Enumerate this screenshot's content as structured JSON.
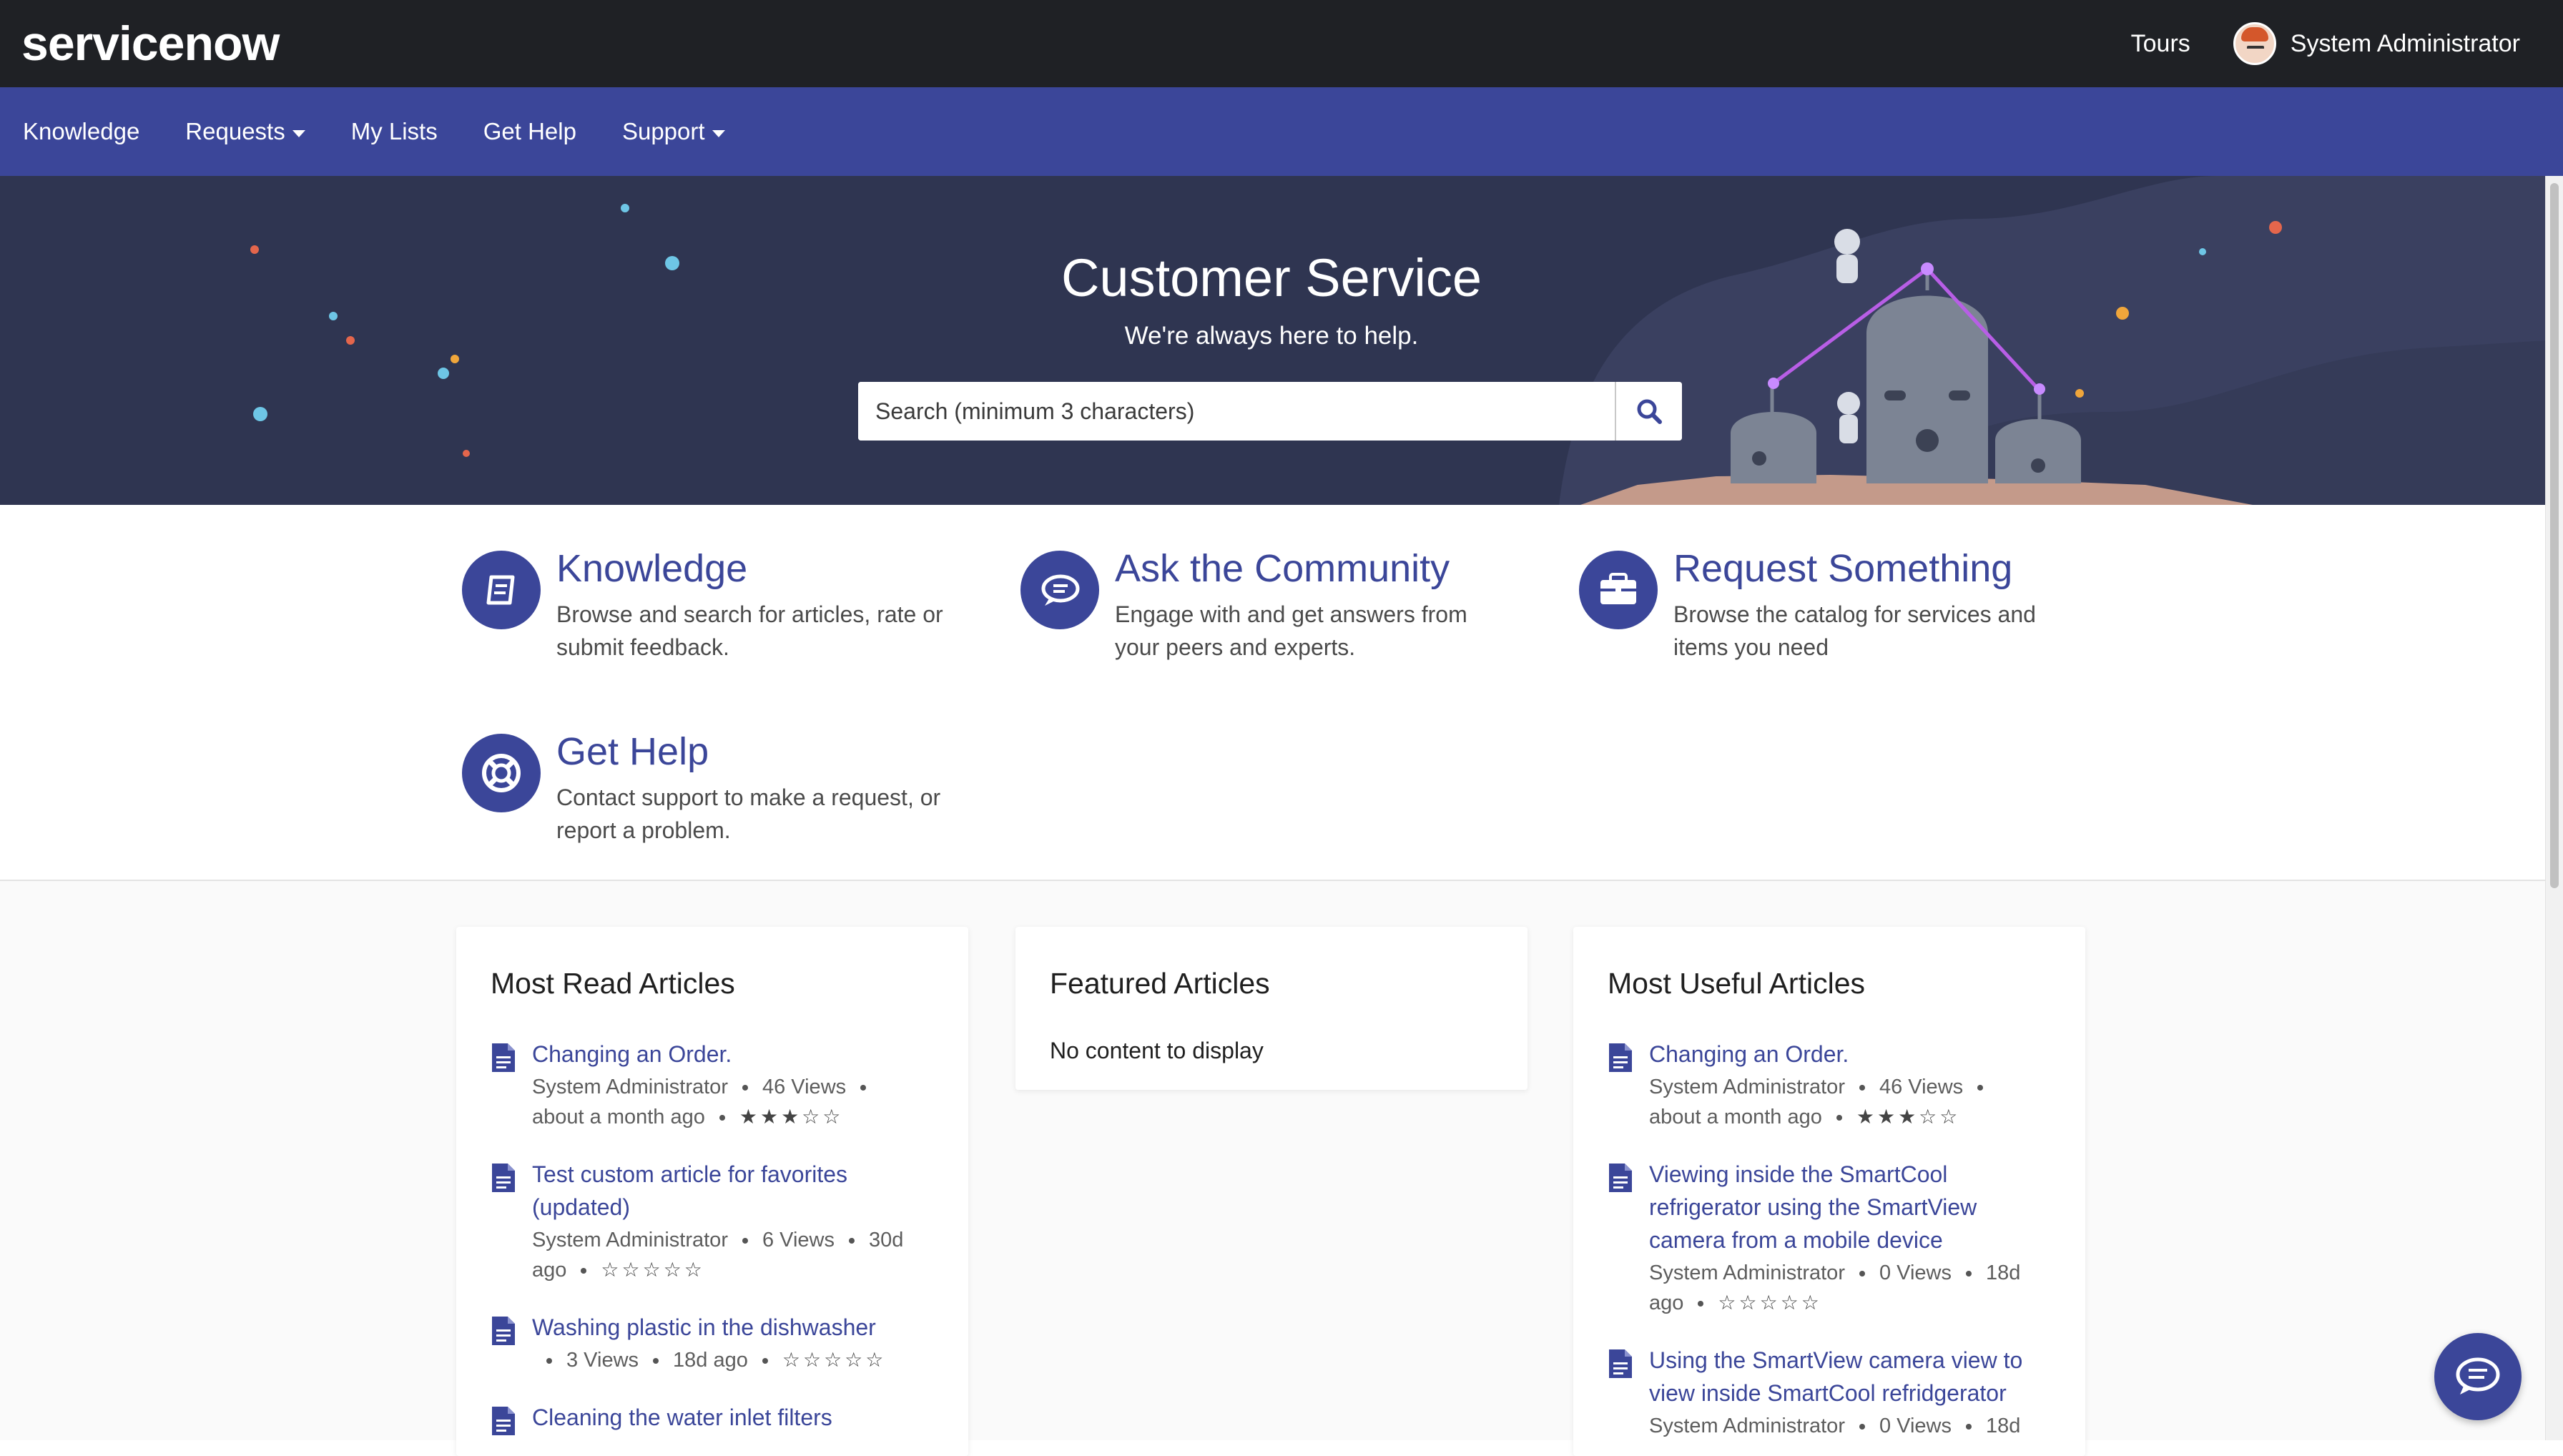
{
  "header": {
    "logo_text": "servicenow",
    "tours_label": "Tours",
    "user_name": "System Administrator"
  },
  "nav": {
    "items": [
      {
        "label": "Knowledge",
        "dropdown": false
      },
      {
        "label": "Requests",
        "dropdown": true
      },
      {
        "label": "My Lists",
        "dropdown": false
      },
      {
        "label": "Get Help",
        "dropdown": false
      },
      {
        "label": "Support",
        "dropdown": true
      }
    ]
  },
  "hero": {
    "title": "Customer Service",
    "subtitle": "We're always here to help.",
    "search_placeholder": "Search (minimum 3 characters)"
  },
  "quick_links": [
    {
      "title": "Knowledge",
      "description": "Browse and search for articles, rate or submit feedback.",
      "icon": "book-icon"
    },
    {
      "title": "Ask the Community",
      "description": "Engage with and get answers from your peers and experts.",
      "icon": "chat-bubbles-icon"
    },
    {
      "title": "Request Something",
      "description": "Browse the catalog for services and items you need",
      "icon": "briefcase-icon"
    },
    {
      "title": "Get Help",
      "description": "Contact support to make a request, or report a problem.",
      "icon": "lifebuoy-icon"
    }
  ],
  "widgets": {
    "most_read": {
      "title": "Most Read Articles",
      "articles": [
        {
          "title": "Changing an Order.",
          "author": "System Administrator",
          "views": "46 Views",
          "age": "about a month ago",
          "stars": "★★★☆☆"
        },
        {
          "title": "Test custom article for favorites (updated)",
          "author": "System Administrator",
          "views": "6 Views",
          "age": "30d ago",
          "stars": "☆☆☆☆☆"
        },
        {
          "title": "Washing plastic in the dishwasher",
          "author": "",
          "views": "3 Views",
          "age": "18d ago",
          "stars": "☆☆☆☆☆"
        },
        {
          "title": "Cleaning the water inlet filters",
          "author": "",
          "views": "",
          "age": "",
          "stars": ""
        }
      ]
    },
    "featured": {
      "title": "Featured Articles",
      "empty_text": "No content to display"
    },
    "most_useful": {
      "title": "Most Useful Articles",
      "articles": [
        {
          "title": "Changing an Order.",
          "author": "System Administrator",
          "views": "46 Views",
          "age": "about a month ago",
          "stars": "★★★☆☆"
        },
        {
          "title": "Viewing inside the SmartCool refrigerator using the SmartView camera from a mobile device",
          "author": "System Administrator",
          "views": "0 Views",
          "age": "18d ago",
          "stars": "☆☆☆☆☆"
        },
        {
          "title": "Using the SmartView camera view to view inside SmartCool refridgerator",
          "author": "System Administrator",
          "views": "0 Views",
          "age": "18d",
          "stars": ""
        }
      ]
    }
  },
  "colors": {
    "header_bg": "#1f2125",
    "nav_bg": "#3b4699",
    "hero_bg": "#2f3551",
    "accent": "#3b4699"
  }
}
